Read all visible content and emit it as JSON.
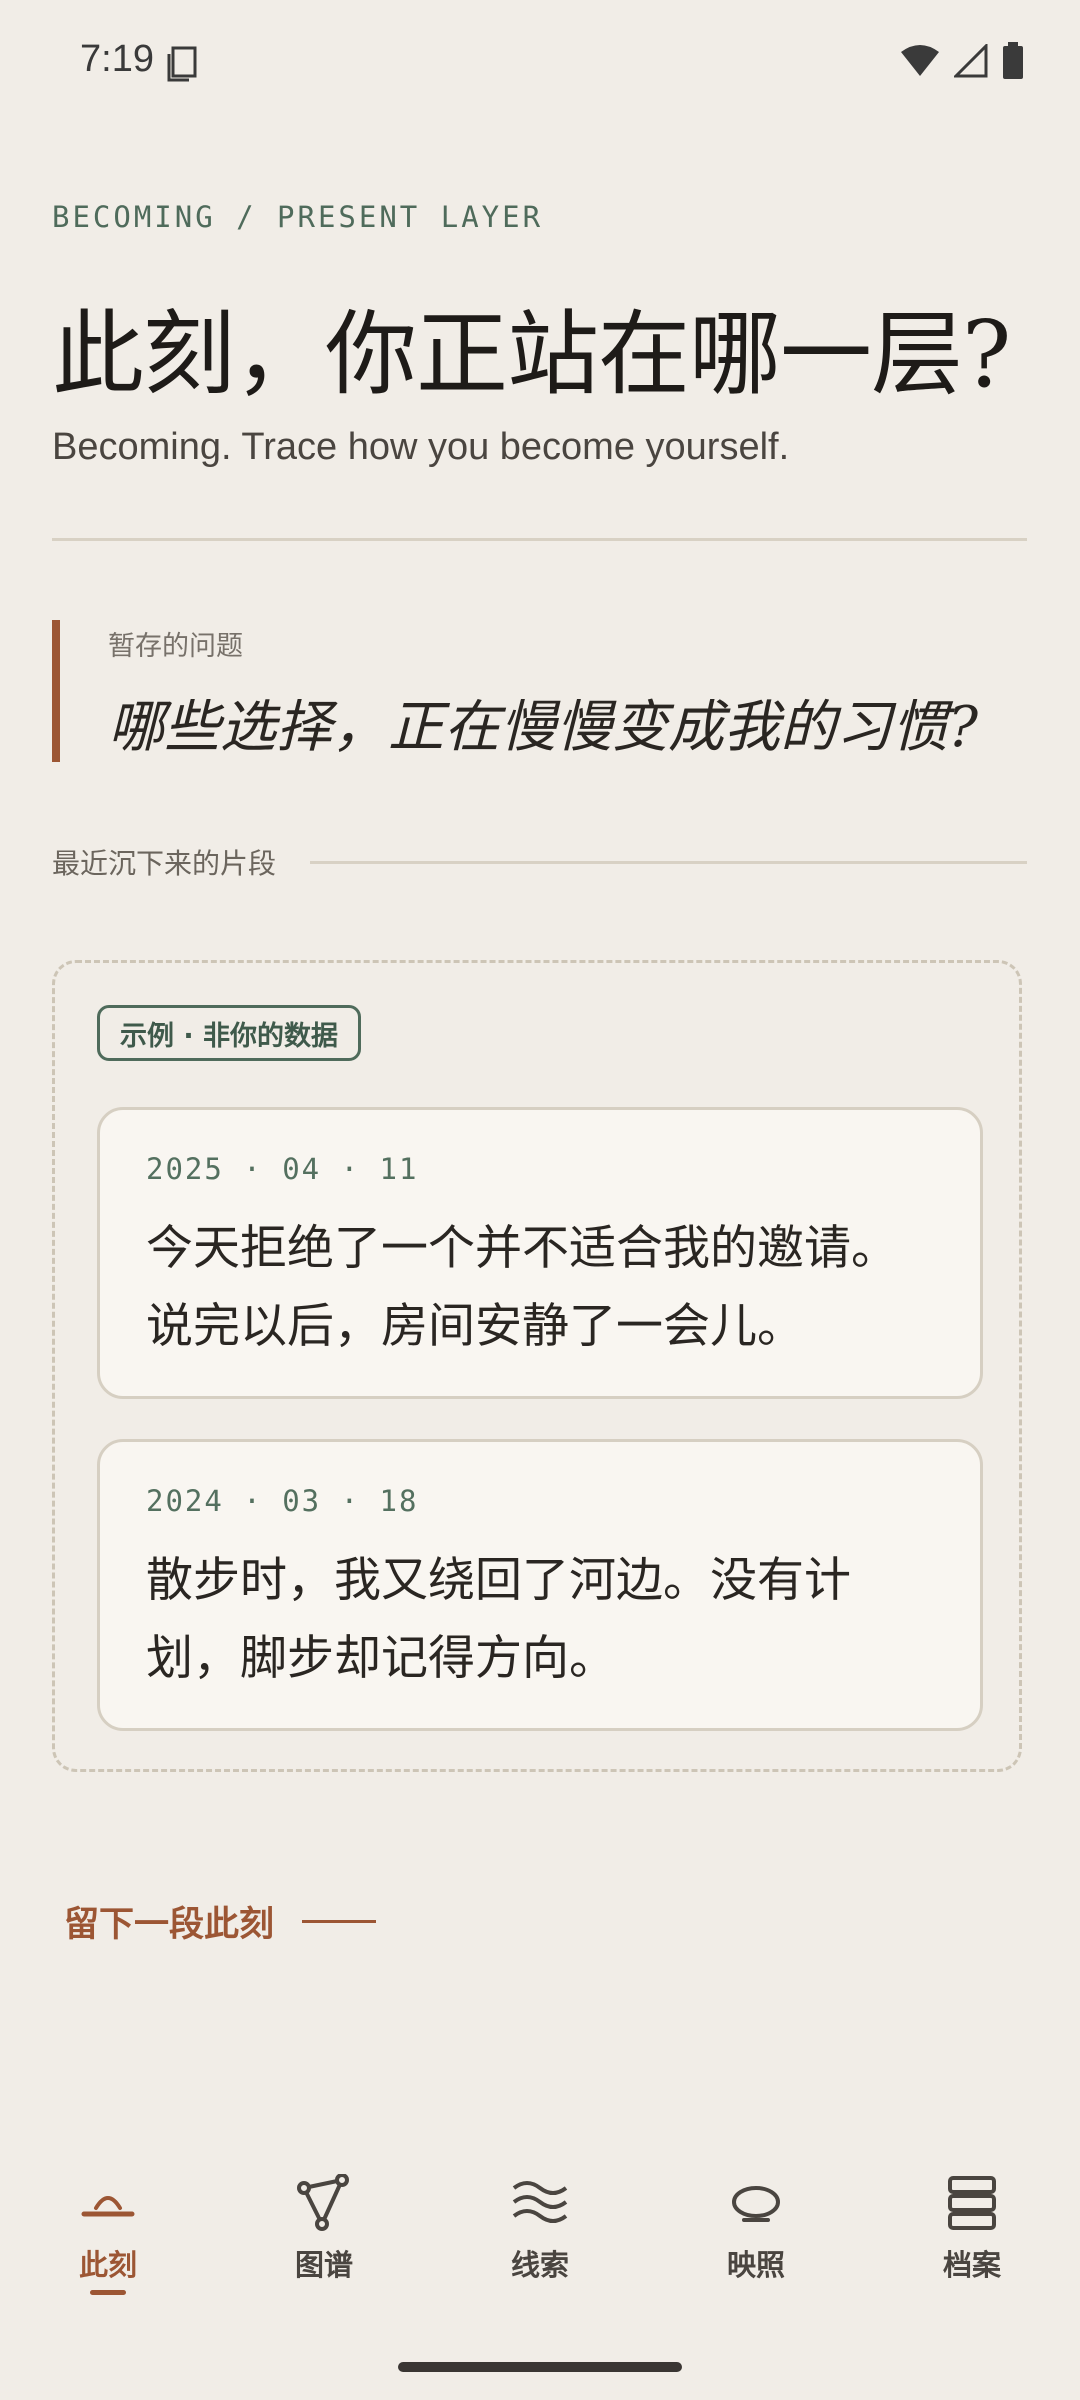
{
  "status_bar": {
    "time": "7:19"
  },
  "header": {
    "eyebrow": "BECOMING / PRESENT LAYER",
    "title": "此刻，你正站在哪一层?",
    "subtitle": "Becoming. Trace how you become yourself."
  },
  "question": {
    "label": "暂存的问题",
    "text": "哪些选择，正在慢慢变成我的习惯?"
  },
  "recent": {
    "heading": "最近沉下来的片段"
  },
  "examples": {
    "badge": "示例 · 非你的数据",
    "cards": [
      {
        "date": "2025 · 04 · 11",
        "text": "今天拒绝了一个并不适合我的邀请。说完以后，房间安静了一会儿。"
      },
      {
        "date": "2024 · 03 · 18",
        "text": "散步时，我又绕回了河边。没有计划，脚步却记得方向。"
      }
    ]
  },
  "cta": {
    "label": "留下一段此刻"
  },
  "nav": {
    "items": [
      {
        "label": "此刻",
        "icon": "horizon-icon",
        "active": true
      },
      {
        "label": "图谱",
        "icon": "graph-icon"
      },
      {
        "label": "线索",
        "icon": "waves-icon"
      },
      {
        "label": "映照",
        "icon": "ellipse-icon"
      },
      {
        "label": "档案",
        "icon": "stack-icon"
      }
    ]
  },
  "colors": {
    "background": "#f1ede7",
    "accent": "#9c5634",
    "green": "#4f6b5b"
  }
}
